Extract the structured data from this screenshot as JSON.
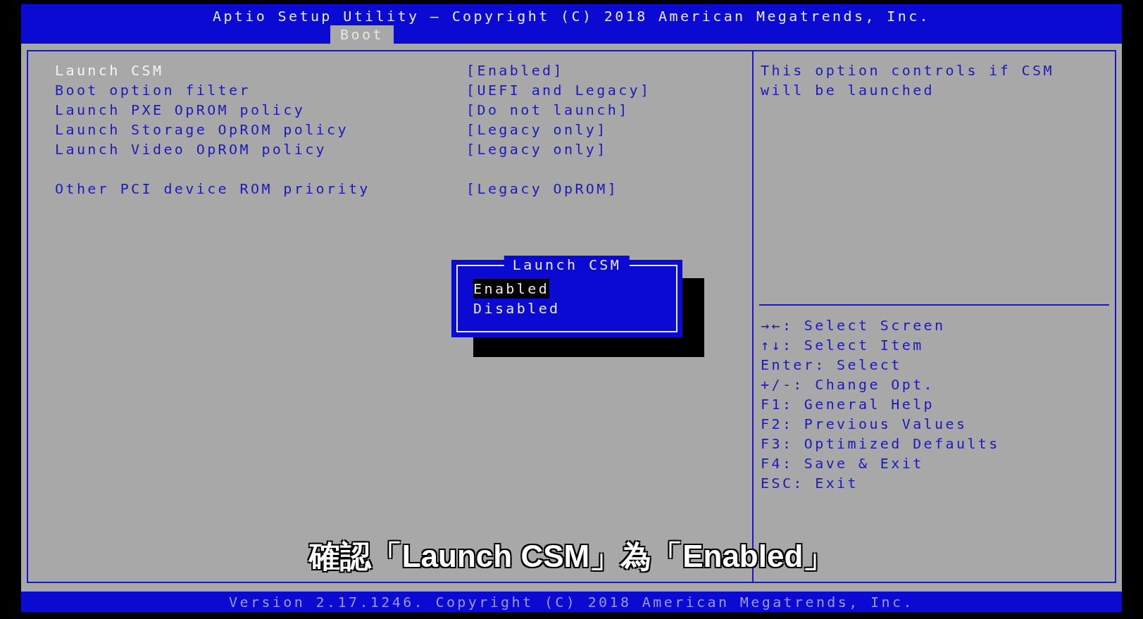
{
  "header": {
    "title": "Aptio Setup Utility – Copyright (C) 2018 American Megatrends, Inc."
  },
  "tabs": [
    {
      "label": "Boot",
      "selected": true
    }
  ],
  "settings": [
    {
      "items": [
        {
          "label": "Launch CSM",
          "value": "[Enabled]",
          "selected": true
        },
        {
          "label": "Boot option filter",
          "value": "[UEFI and Legacy]",
          "selected": false
        },
        {
          "label": "Launch PXE OpROM policy",
          "value": "[Do not launch]",
          "selected": false
        },
        {
          "label": "Launch Storage OpROM policy",
          "value": "[Legacy only]",
          "selected": false
        },
        {
          "label": "Launch Video OpROM policy",
          "value": "[Legacy only]",
          "selected": false
        }
      ]
    },
    {
      "items": [
        {
          "label": "Other PCI device ROM priority",
          "value": "[Legacy OpROM]",
          "selected": false
        }
      ]
    }
  ],
  "help_text": "This option controls if CSM will be launched",
  "key_help": [
    "→←: Select Screen",
    "↑↓: Select Item",
    "Enter: Select",
    "+/-: Change Opt.",
    "F1: General Help",
    "F2: Previous Values",
    "F3: Optimized Defaults",
    "F4: Save & Exit",
    "ESC: Exit"
  ],
  "popup": {
    "title": "Launch CSM",
    "options": [
      {
        "label": "Enabled",
        "selected": true
      },
      {
        "label": "Disabled",
        "selected": false
      }
    ]
  },
  "subtitle": "確認「Launch CSM」為「Enabled」",
  "footer": "Version 2.17.1246. Copyright (C) 2018 American Megatrends, Inc."
}
